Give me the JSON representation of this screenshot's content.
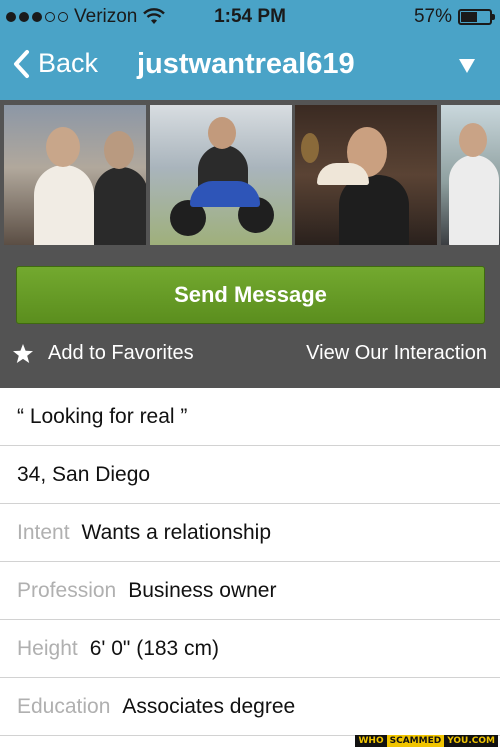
{
  "status_bar": {
    "carrier": "Verizon",
    "time": "1:54 PM",
    "battery_text": "57%",
    "battery_level": 0.57
  },
  "nav": {
    "back_label": "Back",
    "title": "justwantreal619"
  },
  "actions": {
    "send_message": "Send Message",
    "add_favorites": "Add to Favorites",
    "view_interaction": "View Our Interaction"
  },
  "profile": {
    "tagline": "“ Looking for real ”",
    "age_location": "34, San Diego",
    "intent_label": "Intent",
    "intent_value": "Wants a relationship",
    "profession_label": "Profession",
    "profession_value": "Business owner",
    "height_label": "Height",
    "height_value": "6' 0\" (183 cm)",
    "education_label": "Education",
    "education_value": "Associates degree"
  },
  "watermark": {
    "part1": "WHO",
    "part2": "SCAMMED",
    "part3": "YOU.COM"
  },
  "colors": {
    "header": "#4aa3c7",
    "action_bg": "#535353",
    "button_green": "#66a028"
  }
}
